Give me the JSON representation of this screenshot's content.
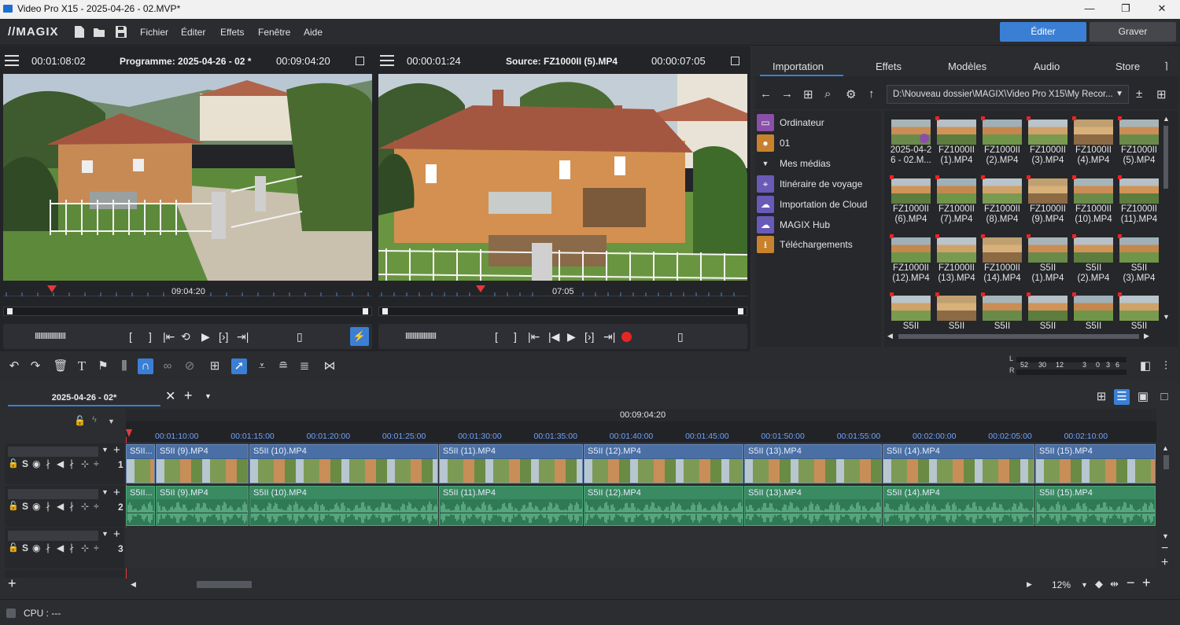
{
  "window": {
    "title": "Video Pro X15 - 2025-04-26 - 02.MVP*",
    "controls": [
      "—",
      "❐",
      "✕"
    ]
  },
  "menubar": {
    "logo": "//MAGIX",
    "items": [
      "Fichier",
      "Éditer",
      "Effets",
      "Fenêtre",
      "Aide"
    ],
    "mode_edit": "Éditer",
    "mode_burn": "Graver"
  },
  "program_monitor": {
    "timecode": "00:01:08:02",
    "title": "Programme: 2025-04-26 - 02 *",
    "duration": "00:09:04:20",
    "ruler_label": "09:04:20"
  },
  "source_monitor": {
    "timecode": "00:00:01:24",
    "title": "Source: FZ1000II (5).MP4",
    "duration": "00:00:07:05",
    "ruler_label": "07:05"
  },
  "pool": {
    "tabs": [
      "Importation",
      "Effets",
      "Modèles",
      "Audio",
      "Store"
    ],
    "path": "D:\\Nouveau dossier\\MAGIX\\Video Pro X15\\My Recor...",
    "tree": [
      {
        "label": "Ordinateur",
        "icon": "computer-icon",
        "color": "#8a4fa8"
      },
      {
        "label": "01",
        "icon": "user-icon",
        "color": "#c8822e"
      },
      {
        "label": "Mes médias",
        "icon": "chevron-down-icon",
        "color": ""
      },
      {
        "label": "Itinéraire de voyage",
        "icon": "location-pin-icon",
        "color": "#6a5ab8"
      },
      {
        "label": "Importation de Cloud",
        "icon": "cloud-icon",
        "color": "#6a5ab8"
      },
      {
        "label": "MAGIX Hub",
        "icon": "cloud-icon",
        "color": "#6a5ab8"
      },
      {
        "label": "Téléchargements",
        "icon": "download-icon",
        "color": "#c8822e"
      }
    ],
    "files": [
      [
        "2025-04-2",
        "6 - 02.M..."
      ],
      [
        "FZ1000II",
        "(1).MP4"
      ],
      [
        "FZ1000II",
        "(2).MP4"
      ],
      [
        "FZ1000II",
        "(3).MP4"
      ],
      [
        "FZ1000II",
        "(4).MP4"
      ],
      [
        "FZ1000II",
        "(5).MP4"
      ],
      [
        "FZ1000II",
        "(6).MP4"
      ],
      [
        "FZ1000II",
        "(7).MP4"
      ],
      [
        "FZ1000II",
        "(8).MP4"
      ],
      [
        "FZ1000II",
        "(9).MP4"
      ],
      [
        "FZ1000II",
        "(10).MP4"
      ],
      [
        "FZ1000II",
        "(11).MP4"
      ],
      [
        "FZ1000II",
        "(12).MP4"
      ],
      [
        "FZ1000II",
        "(13).MP4"
      ],
      [
        "FZ1000II",
        "(14).MP4"
      ],
      [
        "S5II",
        "(1).MP4"
      ],
      [
        "S5II",
        "(2).MP4"
      ],
      [
        "S5II",
        "(3).MP4"
      ],
      [
        "S5II",
        ""
      ],
      [
        "S5II",
        ""
      ],
      [
        "S5II",
        ""
      ],
      [
        "S5II",
        ""
      ],
      [
        "S5II",
        ""
      ],
      [
        "S5II",
        ""
      ]
    ]
  },
  "meter": {
    "l": "L",
    "r": "R",
    "scale": [
      "52",
      "30",
      "12",
      "3",
      "0",
      "3",
      "6"
    ]
  },
  "timeline": {
    "tab": "2025-04-26 - 02*",
    "position": "00:09:04:20",
    "ruler": [
      "00:01:10:00",
      "00:01:15:00",
      "00:01:20:00",
      "00:01:25:00",
      "00:01:30:00",
      "00:01:35:00",
      "00:01:40:00",
      "00:01:45:00",
      "00:01:50:00",
      "00:01:55:00",
      "00:02:00:00",
      "00:02:05:00",
      "00:02:10:00"
    ],
    "video_clips": [
      "S5II...",
      "S5II (9).MP4",
      "S5II (10).MP4",
      "S5II (11).MP4",
      "S5II (12).MP4",
      "S5II (13).MP4",
      "S5II (14).MP4",
      "S5II (15).MP4"
    ],
    "audio_clips": [
      "S5II...",
      "S5II (9).MP4",
      "S5II (10).MP4",
      "S5II (11).MP4",
      "S5II (12).MP4",
      "S5II (13).MP4",
      "S5II (14).MP4",
      "S5II (15).MP4"
    ],
    "tracks": [
      "1",
      "2",
      "3"
    ],
    "track_letter": "S",
    "zoom": "12%"
  },
  "status": {
    "cpu": "CPU : ---"
  }
}
